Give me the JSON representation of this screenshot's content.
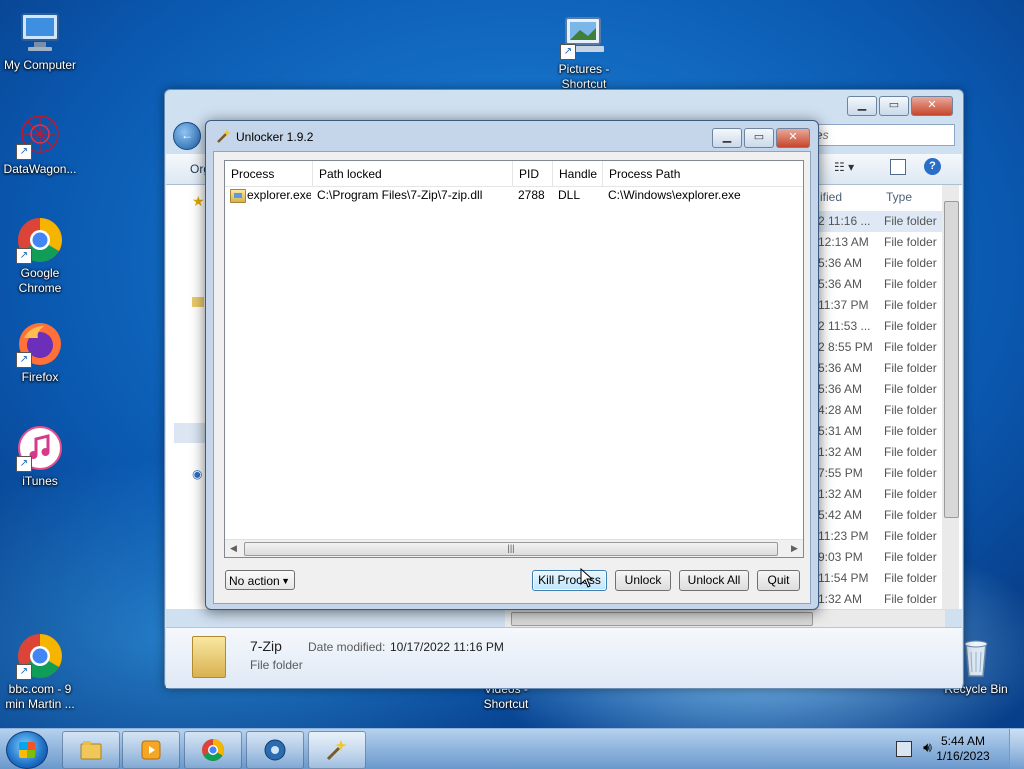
{
  "desktop": {
    "icons": [
      {
        "label": "My Computer"
      },
      {
        "label": "DataWagon..."
      },
      {
        "label": "Google Chrome"
      },
      {
        "label": "Firefox"
      },
      {
        "label": "iTunes"
      },
      {
        "label": "bbc.com - 9 min Martin ..."
      },
      {
        "label": "Pictures - Shortcut"
      },
      {
        "label": "Videos - Shortcut"
      },
      {
        "label": "Recycle Bin"
      }
    ]
  },
  "explorer": {
    "search_placeholder": "es",
    "toolbar_organize": "Org",
    "column_modified": "ified",
    "column_type": "Type",
    "rows": [
      {
        "date": "2 11:16 ...",
        "type": "File folder"
      },
      {
        "date": "12:13 AM",
        "type": "File folder"
      },
      {
        "date": "5:36 AM",
        "type": "File folder"
      },
      {
        "date": "5:36 AM",
        "type": "File folder"
      },
      {
        "date": "11:37 PM",
        "type": "File folder"
      },
      {
        "date": "2 11:53 ...",
        "type": "File folder"
      },
      {
        "date": "2 8:55 PM",
        "type": "File folder"
      },
      {
        "date": "5:36 AM",
        "type": "File folder"
      },
      {
        "date": "5:36 AM",
        "type": "File folder"
      },
      {
        "date": "4:28 AM",
        "type": "File folder"
      },
      {
        "date": "5:31 AM",
        "type": "File folder"
      },
      {
        "date": "1:32 AM",
        "type": "File folder"
      },
      {
        "date": "7:55 PM",
        "type": "File folder"
      },
      {
        "date": "1:32 AM",
        "type": "File folder"
      },
      {
        "date": "5:42 AM",
        "type": "File folder"
      },
      {
        "date": "11:23 PM",
        "type": "File folder"
      },
      {
        "date": "9:03 PM",
        "type": "File folder"
      },
      {
        "date": "11:54 PM",
        "type": "File folder"
      },
      {
        "date": "1:32 AM",
        "type": "File folder"
      }
    ],
    "details": {
      "name": "7-Zip",
      "type": "File folder",
      "modified_label": "Date modified:",
      "modified_value": "10/17/2022 11:16 PM"
    }
  },
  "unlocker": {
    "title": "Unlocker 1.9.2",
    "columns": [
      "Process",
      "Path locked",
      "PID",
      "Handle",
      "Process Path"
    ],
    "rows": [
      {
        "process": "explorer.exe",
        "path_locked": "C:\\Program Files\\7-Zip\\7-zip.dll",
        "pid": "2788",
        "handle": "DLL",
        "process_path": "C:\\Windows\\explorer.exe"
      }
    ],
    "action_select": "No action",
    "buttons": {
      "kill_process": "Kill Process",
      "unlock": "Unlock",
      "unlock_all": "Unlock All",
      "quit": "Quit"
    }
  },
  "taskbar": {
    "time": "5:44 AM",
    "date": "1/16/2023"
  }
}
